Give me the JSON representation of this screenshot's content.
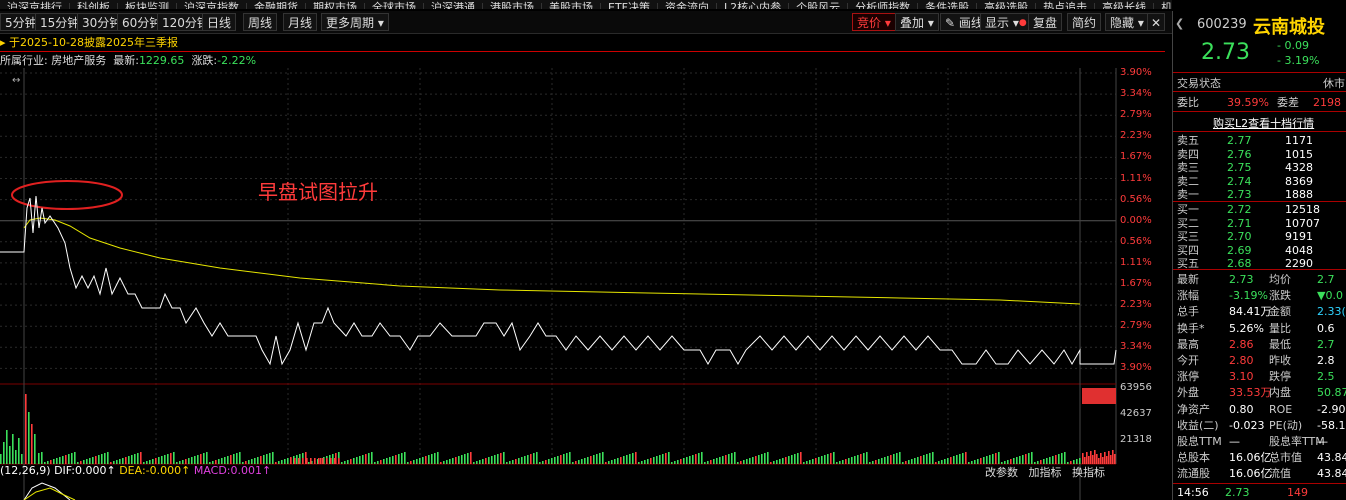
{
  "topnav": [
    "沪深京排行",
    "科创板",
    "板块监测",
    "沪深京指数",
    "金融期货",
    "期权市场",
    "全球市场",
    "沪深港通",
    "港股市场",
    "美股市场",
    "ETF决策",
    "资金流向",
    "L2核心内参",
    "个股风云",
    "分析师指数",
    "条件选股",
    "高级选股",
    "热点追击",
    "高级长线",
    "机构增仓"
  ],
  "toolbar": {
    "periods": [
      "5分钟",
      "15分钟",
      "30分钟",
      "60分钟",
      "120分钟",
      "日线",
      "周线",
      "月线"
    ],
    "more": "更多周期",
    "bid": "竞价",
    "overlay": "叠加",
    "draw": "画线",
    "display": "显示",
    "review": "复盘",
    "simple": "简约",
    "hide": "隐藏"
  },
  "info1": {
    "text": "于2025-10-28披露2025年三季报"
  },
  "info2": {
    "industry_label": "所属行业:",
    "industry": "房地产服务",
    "latest_label": "最新:",
    "latest": "1229.65",
    "change_label": "涨跌:",
    "change": "-2.22%"
  },
  "annotation": "早盘试图拉升",
  "price_axis": [
    "3.90%",
    "3.34%",
    "2.79%",
    "2.23%",
    "1.67%",
    "1.11%",
    "0.56%",
    "0.00%",
    "0.56%",
    "1.11%",
    "1.67%",
    "2.23%",
    "2.79%",
    "3.34%",
    "3.90%"
  ],
  "volume_axis": [
    "63956",
    "42637",
    "21318"
  ],
  "macd": {
    "params": "(12,26,9)",
    "dif": "DIF:0.000↑",
    "dea": "DEA:-0.000↑",
    "macd": "MACD:0.001↑"
  },
  "bottom_tools": [
    "改参数",
    "加指标",
    "换指标"
  ],
  "stock": {
    "code": "600239",
    "name": "云南城投",
    "price": "2.73",
    "change": "- 0.09",
    "change_pct": "- 3.19%"
  },
  "status": {
    "label": "交易状态",
    "value": "休市"
  },
  "ratio": {
    "label": "委比",
    "value": "39.59%",
    "diff_label": "委差",
    "diff": "2198"
  },
  "l2_link": "购买L2查看十档行情",
  "asks": [
    {
      "label": "卖五",
      "price": "2.77",
      "vol": "1171"
    },
    {
      "label": "卖四",
      "price": "2.76",
      "vol": "1015"
    },
    {
      "label": "卖三",
      "price": "2.75",
      "vol": "4328"
    },
    {
      "label": "卖二",
      "price": "2.74",
      "vol": "8369"
    },
    {
      "label": "卖一",
      "price": "2.73",
      "vol": "1888"
    }
  ],
  "bids": [
    {
      "label": "买一",
      "price": "2.72",
      "vol": "12518"
    },
    {
      "label": "买二",
      "price": "2.71",
      "vol": "10707"
    },
    {
      "label": "买三",
      "price": "2.70",
      "vol": "9191"
    },
    {
      "label": "买四",
      "price": "2.69",
      "vol": "4048"
    },
    {
      "label": "买五",
      "price": "2.68",
      "vol": "2290"
    }
  ],
  "stats": [
    {
      "l1": "最新",
      "v1": "2.73",
      "c1": "g",
      "l2": "均价",
      "v2": "2.7",
      "c2": "g"
    },
    {
      "l1": "涨幅",
      "v1": "-3.19%",
      "c1": "g",
      "l2": "涨跌",
      "v2": "▼0.0",
      "c2": "g"
    },
    {
      "l1": "总手",
      "v1": "84.41万",
      "c1": "w",
      "l2": "金额",
      "v2": "2.33(",
      "c2": "c"
    },
    {
      "l1": "换手*",
      "v1": "5.26%",
      "c1": "w",
      "l2": "量比",
      "v2": "0.6",
      "c2": "w"
    },
    {
      "l1": "最高",
      "v1": "2.86",
      "c1": "r",
      "l2": "最低",
      "v2": "2.7",
      "c2": "g"
    },
    {
      "l1": "今开",
      "v1": "2.80",
      "c1": "r",
      "l2": "昨收",
      "v2": "2.8",
      "c2": "w"
    },
    {
      "l1": "涨停",
      "v1": "3.10",
      "c1": "r",
      "l2": "跌停",
      "v2": "2.5",
      "c2": "g"
    },
    {
      "l1": "外盘",
      "v1": "33.53万",
      "c1": "r",
      "l2": "内盘",
      "v2": "50.87",
      "c2": "g"
    },
    {
      "l1": "净资产",
      "v1": "0.80",
      "c1": "w",
      "l2": "ROE",
      "v2": "-2.90",
      "c2": "w"
    },
    {
      "l1": "收益(二)",
      "v1": "-0.023",
      "c1": "w",
      "l2": "PE(动)",
      "v2": "-58.1",
      "c2": "w"
    },
    {
      "l1": "股息TTM",
      "v1": "—",
      "c1": "w",
      "l2": "股息率TTM",
      "v2": "—",
      "c2": "w"
    },
    {
      "l1": "总股本",
      "v1": "16.06亿",
      "c1": "w",
      "l2": "总市值",
      "v2": "43.84",
      "c2": "w"
    },
    {
      "l1": "流通股",
      "v1": "16.06亿",
      "c1": "w",
      "l2": "流值",
      "v2": "43.84",
      "c2": "w"
    }
  ],
  "tick": {
    "time": "14:56",
    "price": "2.73",
    "vol": "149"
  },
  "colors": {
    "up": "#ff3b3b",
    "down": "#3be05b",
    "avg": "#e6e600",
    "line": "#ffffff"
  }
}
